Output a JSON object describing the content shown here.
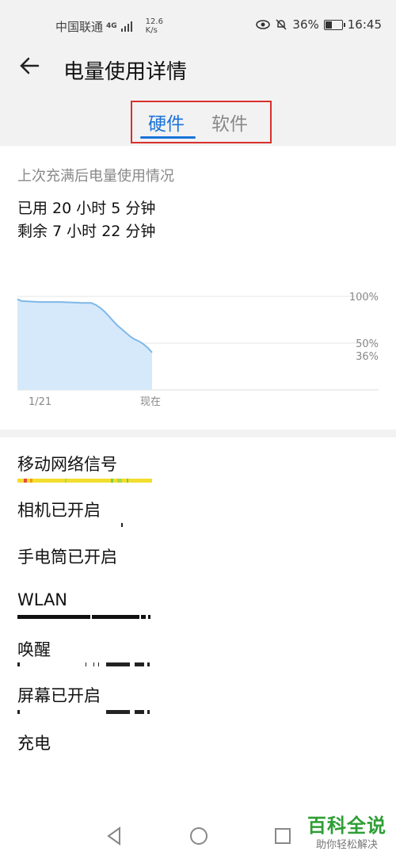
{
  "status_bar": {
    "carrier": "中国联通",
    "network": "4G",
    "speed_value": "12.6",
    "speed_unit": "K/s",
    "battery": "36%",
    "time": "16:45",
    "icons": [
      "eye-icon",
      "bell-off-icon",
      "battery-icon",
      "signal-icon"
    ]
  },
  "header": {
    "title": "电量使用详情",
    "tabs": [
      {
        "label": "硬件",
        "active": true
      },
      {
        "label": "软件",
        "active": false
      }
    ]
  },
  "summary": {
    "since_label": "上次充满后电量使用情况",
    "used": "已用 20 小时 5 分钟",
    "remaining": "剩余 7 小时 22 分钟"
  },
  "chart_data": {
    "type": "area",
    "x_labels": [
      "1/21",
      "现在"
    ],
    "y_labels": [
      "100%",
      "50%",
      "36%"
    ],
    "ylim": [
      0,
      100
    ],
    "x": [
      0,
      0.5,
      1,
      5,
      10,
      15,
      17,
      18,
      19,
      20,
      21,
      22,
      23,
      24,
      25,
      26,
      27,
      28,
      29,
      30,
      31
    ],
    "values": [
      97,
      96,
      95,
      94,
      94,
      93,
      93,
      91,
      88,
      84,
      79,
      74,
      69,
      65,
      61,
      57,
      54,
      52,
      49,
      45,
      40
    ],
    "color": "#7fb8e8"
  },
  "usage_items": [
    {
      "label": "移动网络信号"
    },
    {
      "label": "相机已开启"
    },
    {
      "label": "手电筒已开启"
    },
    {
      "label": "WLAN"
    },
    {
      "label": "唤醒"
    },
    {
      "label": "屏幕已开启"
    },
    {
      "label": "充电"
    }
  ],
  "watermark": {
    "brand": "百科全说",
    "slogan": "助你轻松解决"
  }
}
